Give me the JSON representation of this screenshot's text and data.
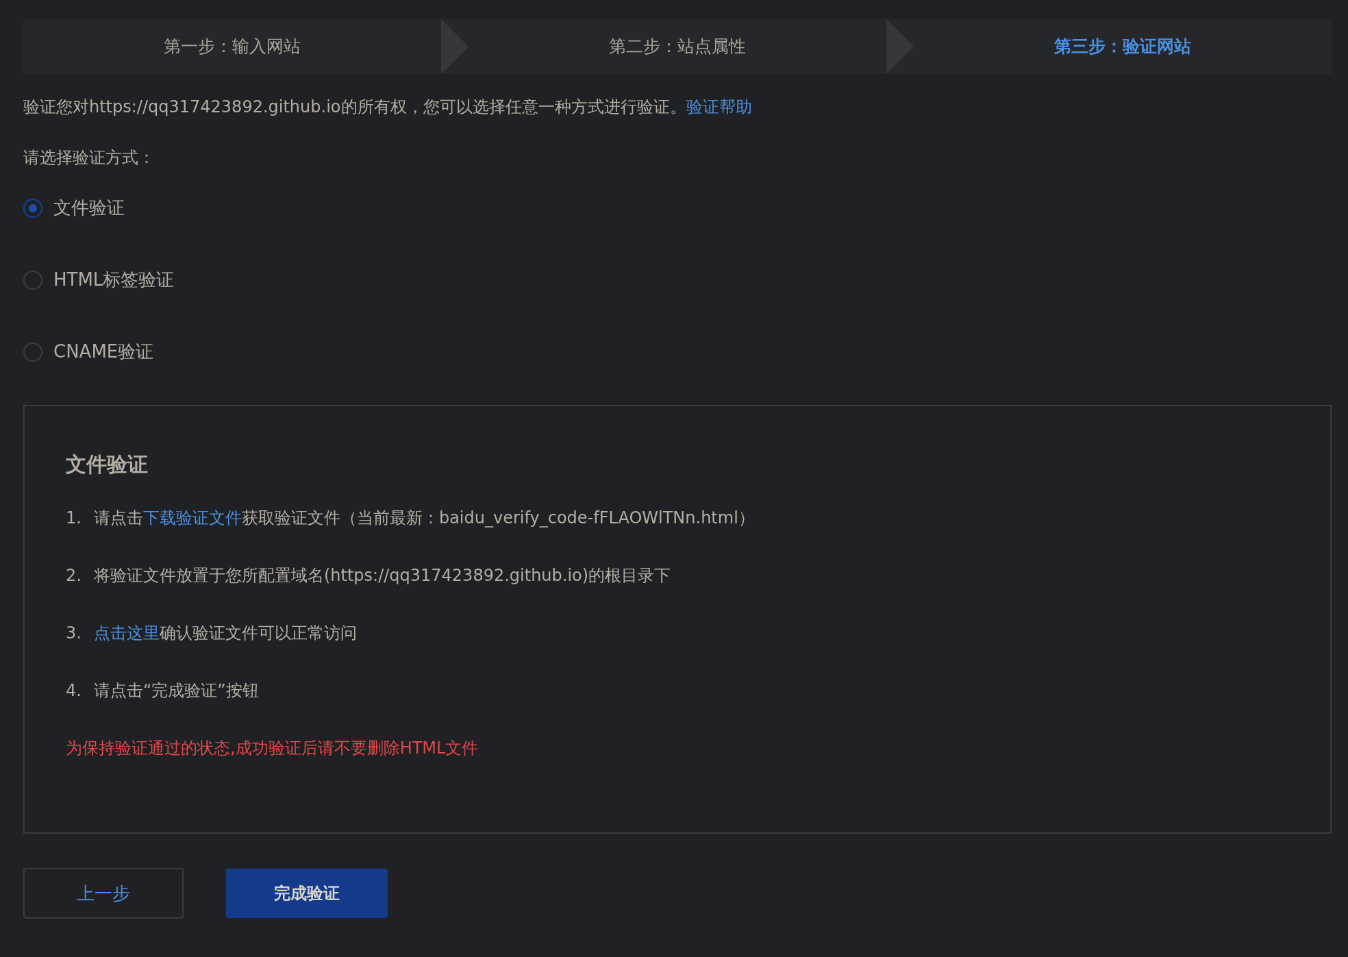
{
  "steps": [
    {
      "label": "第一步：输入网站",
      "selected": false
    },
    {
      "label": "第二步：站点属性",
      "selected": false
    },
    {
      "label": "第三步：验证网站",
      "selected": true
    }
  ],
  "intro": {
    "text": "验证您对https://qq317423892.github.io的所有权，您可以选择任意一种方式进行验证。",
    "link": "验证帮助"
  },
  "method_label": "请选择验证方式：",
  "methods": [
    {
      "label": "文件验证",
      "selected": true
    },
    {
      "label": "HTML标签验证",
      "selected": false
    },
    {
      "label": "CNAME验证",
      "selected": false
    }
  ],
  "panel": {
    "title": "文件验证",
    "items": [
      {
        "number": "1.",
        "parts": [
          {
            "kind": "text",
            "text": "请点击"
          },
          {
            "kind": "link",
            "text": "下载验证文件"
          },
          {
            "kind": "text",
            "text": "获取验证文件（当前最新：baidu_verify_code-fFLAOWlTNn.html）"
          }
        ]
      },
      {
        "number": "2.",
        "parts": [
          {
            "kind": "text",
            "text": "将验证文件放置于您所配置域名(https://qq317423892.github.io)的根目录下"
          }
        ]
      },
      {
        "number": "3.",
        "parts": [
          {
            "kind": "link",
            "text": "点击这里"
          },
          {
            "kind": "text",
            "text": "确认验证文件可以正常访问"
          }
        ]
      },
      {
        "number": "4.",
        "parts": [
          {
            "kind": "text",
            "text": "请点击“完成验证”按钮"
          }
        ]
      }
    ],
    "warning": "为保持验证通过的状态,成功验证后请不要删除HTML文件"
  },
  "buttons": [
    {
      "label": "上一步",
      "kind": "secondary"
    },
    {
      "label": "完成验证",
      "kind": "primary"
    }
  ]
}
